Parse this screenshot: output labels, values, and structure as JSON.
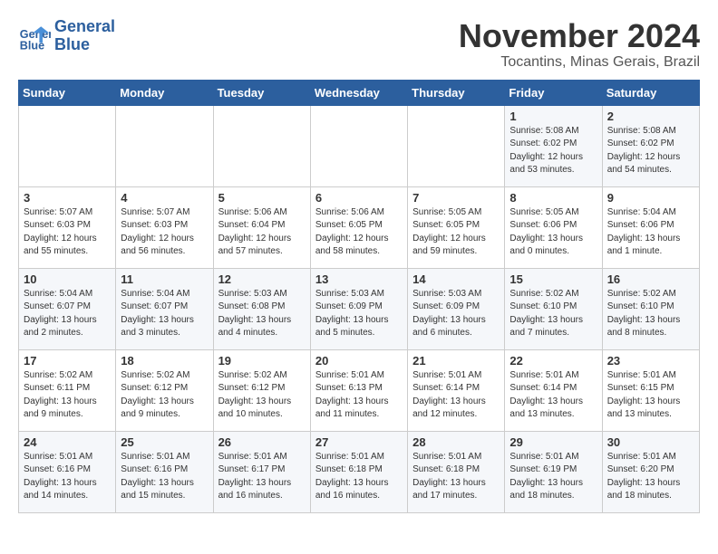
{
  "header": {
    "logo_line1": "General",
    "logo_line2": "Blue",
    "month_title": "November 2024",
    "subtitle": "Tocantins, Minas Gerais, Brazil"
  },
  "weekdays": [
    "Sunday",
    "Monday",
    "Tuesday",
    "Wednesday",
    "Thursday",
    "Friday",
    "Saturday"
  ],
  "weeks": [
    [
      {
        "day": "",
        "info": ""
      },
      {
        "day": "",
        "info": ""
      },
      {
        "day": "",
        "info": ""
      },
      {
        "day": "",
        "info": ""
      },
      {
        "day": "",
        "info": ""
      },
      {
        "day": "1",
        "info": "Sunrise: 5:08 AM\nSunset: 6:02 PM\nDaylight: 12 hours\nand 53 minutes."
      },
      {
        "day": "2",
        "info": "Sunrise: 5:08 AM\nSunset: 6:02 PM\nDaylight: 12 hours\nand 54 minutes."
      }
    ],
    [
      {
        "day": "3",
        "info": "Sunrise: 5:07 AM\nSunset: 6:03 PM\nDaylight: 12 hours\nand 55 minutes."
      },
      {
        "day": "4",
        "info": "Sunrise: 5:07 AM\nSunset: 6:03 PM\nDaylight: 12 hours\nand 56 minutes."
      },
      {
        "day": "5",
        "info": "Sunrise: 5:06 AM\nSunset: 6:04 PM\nDaylight: 12 hours\nand 57 minutes."
      },
      {
        "day": "6",
        "info": "Sunrise: 5:06 AM\nSunset: 6:05 PM\nDaylight: 12 hours\nand 58 minutes."
      },
      {
        "day": "7",
        "info": "Sunrise: 5:05 AM\nSunset: 6:05 PM\nDaylight: 12 hours\nand 59 minutes."
      },
      {
        "day": "8",
        "info": "Sunrise: 5:05 AM\nSunset: 6:06 PM\nDaylight: 13 hours\nand 0 minutes."
      },
      {
        "day": "9",
        "info": "Sunrise: 5:04 AM\nSunset: 6:06 PM\nDaylight: 13 hours\nand 1 minute."
      }
    ],
    [
      {
        "day": "10",
        "info": "Sunrise: 5:04 AM\nSunset: 6:07 PM\nDaylight: 13 hours\nand 2 minutes."
      },
      {
        "day": "11",
        "info": "Sunrise: 5:04 AM\nSunset: 6:07 PM\nDaylight: 13 hours\nand 3 minutes."
      },
      {
        "day": "12",
        "info": "Sunrise: 5:03 AM\nSunset: 6:08 PM\nDaylight: 13 hours\nand 4 minutes."
      },
      {
        "day": "13",
        "info": "Sunrise: 5:03 AM\nSunset: 6:09 PM\nDaylight: 13 hours\nand 5 minutes."
      },
      {
        "day": "14",
        "info": "Sunrise: 5:03 AM\nSunset: 6:09 PM\nDaylight: 13 hours\nand 6 minutes."
      },
      {
        "day": "15",
        "info": "Sunrise: 5:02 AM\nSunset: 6:10 PM\nDaylight: 13 hours\nand 7 minutes."
      },
      {
        "day": "16",
        "info": "Sunrise: 5:02 AM\nSunset: 6:10 PM\nDaylight: 13 hours\nand 8 minutes."
      }
    ],
    [
      {
        "day": "17",
        "info": "Sunrise: 5:02 AM\nSunset: 6:11 PM\nDaylight: 13 hours\nand 9 minutes."
      },
      {
        "day": "18",
        "info": "Sunrise: 5:02 AM\nSunset: 6:12 PM\nDaylight: 13 hours\nand 9 minutes."
      },
      {
        "day": "19",
        "info": "Sunrise: 5:02 AM\nSunset: 6:12 PM\nDaylight: 13 hours\nand 10 minutes."
      },
      {
        "day": "20",
        "info": "Sunrise: 5:01 AM\nSunset: 6:13 PM\nDaylight: 13 hours\nand 11 minutes."
      },
      {
        "day": "21",
        "info": "Sunrise: 5:01 AM\nSunset: 6:14 PM\nDaylight: 13 hours\nand 12 minutes."
      },
      {
        "day": "22",
        "info": "Sunrise: 5:01 AM\nSunset: 6:14 PM\nDaylight: 13 hours\nand 13 minutes."
      },
      {
        "day": "23",
        "info": "Sunrise: 5:01 AM\nSunset: 6:15 PM\nDaylight: 13 hours\nand 13 minutes."
      }
    ],
    [
      {
        "day": "24",
        "info": "Sunrise: 5:01 AM\nSunset: 6:16 PM\nDaylight: 13 hours\nand 14 minutes."
      },
      {
        "day": "25",
        "info": "Sunrise: 5:01 AM\nSunset: 6:16 PM\nDaylight: 13 hours\nand 15 minutes."
      },
      {
        "day": "26",
        "info": "Sunrise: 5:01 AM\nSunset: 6:17 PM\nDaylight: 13 hours\nand 16 minutes."
      },
      {
        "day": "27",
        "info": "Sunrise: 5:01 AM\nSunset: 6:18 PM\nDaylight: 13 hours\nand 16 minutes."
      },
      {
        "day": "28",
        "info": "Sunrise: 5:01 AM\nSunset: 6:18 PM\nDaylight: 13 hours\nand 17 minutes."
      },
      {
        "day": "29",
        "info": "Sunrise: 5:01 AM\nSunset: 6:19 PM\nDaylight: 13 hours\nand 18 minutes."
      },
      {
        "day": "30",
        "info": "Sunrise: 5:01 AM\nSunset: 6:20 PM\nDaylight: 13 hours\nand 18 minutes."
      }
    ]
  ]
}
